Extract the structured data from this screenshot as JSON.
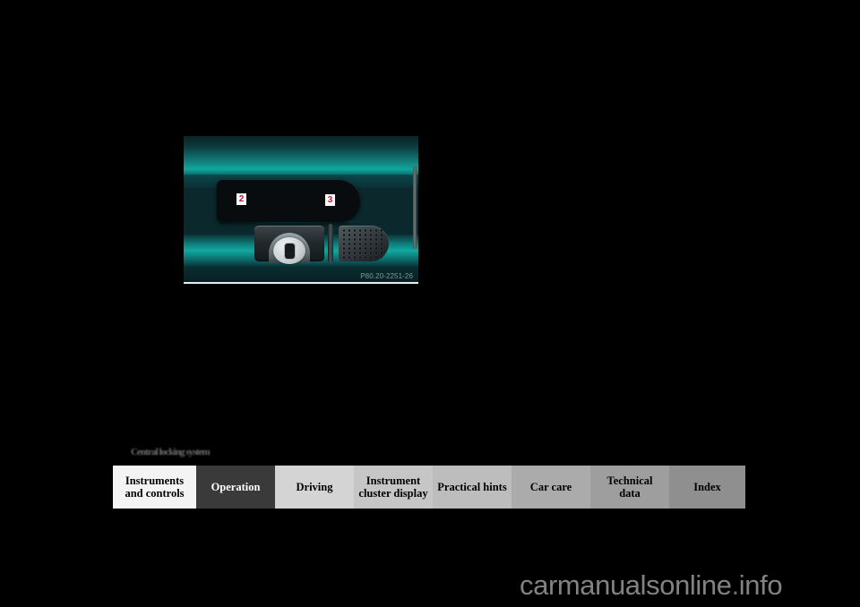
{
  "figure": {
    "caption": "P80.20-2251-26",
    "callouts": [
      {
        "number": "2",
        "target": "central-locking-button"
      },
      {
        "number": "3",
        "target": "speaker-grille"
      }
    ],
    "alt": "Mercedes-Benz door panel showing central locking rocker switch and speaker grille"
  },
  "section": {
    "heading": "Central locking system"
  },
  "nav": {
    "tabs": [
      {
        "label": "Instruments\nand controls",
        "line1": "Instruments",
        "line2": "and controls",
        "active": false,
        "bg": "#f4f4f4",
        "width": 93
      },
      {
        "label": "Operation",
        "line1": "Operation",
        "line2": "",
        "active": true,
        "bg": "#3a3a3a",
        "width": 88
      },
      {
        "label": "Driving",
        "line1": "Driving",
        "line2": "",
        "active": false,
        "bg": "#d4d4d4",
        "width": 88
      },
      {
        "label": "Instrument\ncluster display",
        "line1": "Instrument",
        "line2": "cluster display",
        "active": false,
        "bg": "#c6c6c6",
        "width": 88
      },
      {
        "label": "Practical hints",
        "line1": "Practical hints",
        "line2": "",
        "active": false,
        "bg": "#bdbdbd",
        "width": 88
      },
      {
        "label": "Car care",
        "line1": "Car care",
        "line2": "",
        "active": false,
        "bg": "#ababab",
        "width": 88
      },
      {
        "label": "Technical\ndata",
        "line1": "Technical",
        "line2": "data",
        "active": false,
        "bg": "#9e9e9e",
        "width": 88
      },
      {
        "label": "Index",
        "line1": "Index",
        "line2": "",
        "active": false,
        "bg": "#8f8f8f",
        "width": 85
      }
    ]
  },
  "watermark": {
    "text": "carmanualsonline.info",
    "part1": "carmanualsonline",
    "dot": ".",
    "part2": "info"
  },
  "colors": {
    "page_background": "#000000",
    "figure_teal_light": "#10a9a0",
    "figure_teal_dark": "#0a2326",
    "callout_red": "#c8102e",
    "active_tab_bg": "#3a3a3a",
    "watermark_gray": "#828282"
  }
}
